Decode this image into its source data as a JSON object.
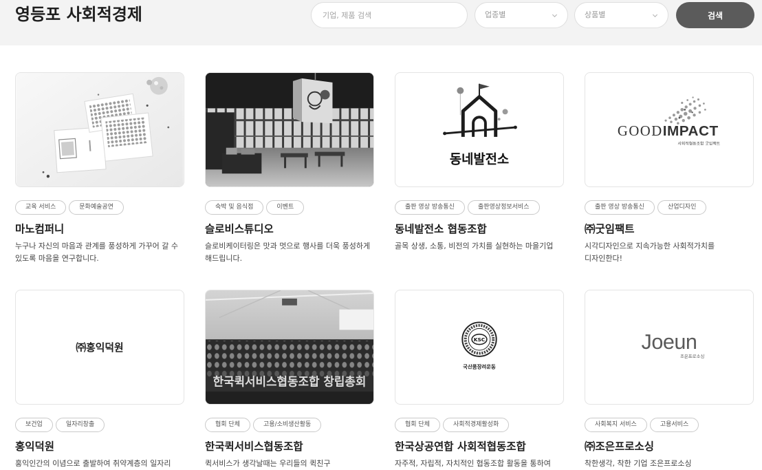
{
  "header": {
    "title": "영등포 사회적경제",
    "search": {
      "placeholder": "기업, 제품 검색"
    },
    "industry_filter": {
      "selected": "업종별"
    },
    "product_filter": {
      "selected": "상품별"
    },
    "search_button": "검색"
  },
  "colors": {
    "header_background": "#f3f3f3",
    "button_background": "#5b5b5b",
    "text": "#1f1f1f"
  },
  "companies": [
    {
      "name": "마노컴퍼니",
      "tags": [
        "교육 서비스",
        "문화예술공연"
      ],
      "description": "누구나 자신의 마음과 관계를 풍성하게 가꾸어 갈 수 있도록 마음을 연구합니다."
    },
    {
      "name": "슬로비스튜디오",
      "tags": [
        "숙박 및 음식점",
        "이벤트"
      ],
      "description": "슬로비케이터링은 맛과 멋으로 행사를 더욱 풍성하게 해드립니다."
    },
    {
      "name": "동네발전소 협동조합",
      "tags": [
        "출판 영상 방송통신",
        "출판영상정보서비스"
      ],
      "description": "골목 상생, 소통, 비전의 가치를 실현하는 마을기업",
      "thumbnail": {
        "text": "동네발전소"
      }
    },
    {
      "name": "㈜굿임팩트",
      "tags": [
        "출판 영상 방송통신",
        "산업디자인"
      ],
      "description": "시각디자인으로 지속가능한 사회적가치를 디자인한다!",
      "thumbnail": {
        "text_regular": "GOOD",
        "text_bold": "IMPACT",
        "subtext": "사회적협동조합 굿임팩트"
      }
    },
    {
      "name": "홍익덕원",
      "tags": [
        "보건업",
        "일자리창출"
      ],
      "description": "홍익인간의 이념으로 출발하여 취약계층의 일자리",
      "thumbnail": {
        "text": "㈜홍익덕원"
      }
    },
    {
      "name": "한국퀵서비스협동조합",
      "tags": [
        "협회 단체",
        "고용/소비생산활동"
      ],
      "description": "퀵서비스가 생각날때는 우리들의 퀵친구",
      "thumbnail": {
        "caption": "한국퀵서비스협동조합 창립총회"
      }
    },
    {
      "name": "한국상공연합 사회적협동조합",
      "tags": [
        "협회 단체",
        "사회적경제활성화"
      ],
      "description": "자주적, 자립적, 자치적인 협동조합 활동을 통하여",
      "thumbnail": {
        "emblem": "KSC",
        "text": "국산품장려운동"
      }
    },
    {
      "name": "㈜조은프로소싱",
      "tags": [
        "사회복지 서비스",
        "고용서비스"
      ],
      "description": "착한생각, 착한 기업 조은프로소싱",
      "thumbnail": {
        "text": "Joeun",
        "subtext": "조은프로소싱"
      }
    }
  ]
}
